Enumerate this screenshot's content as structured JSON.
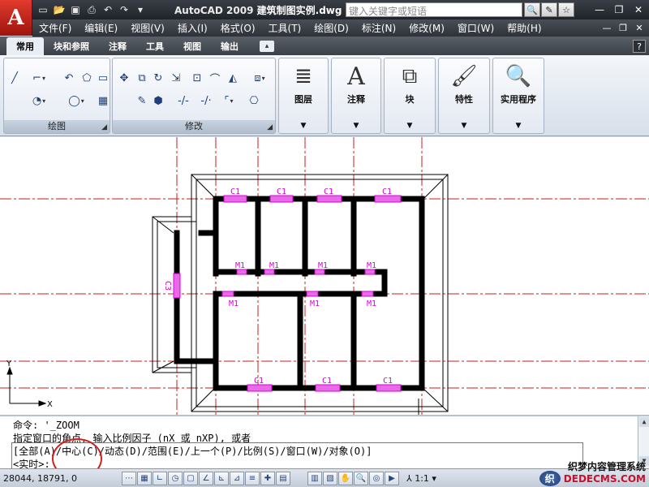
{
  "app": {
    "logo_letter": "A",
    "title_prefix": "AutoCAD 2009",
    "file_name": "建筑制图实例.dwg",
    "search_placeholder": "键入关键字或短语"
  },
  "menu": [
    "文件(F)",
    "编辑(E)",
    "视图(V)",
    "插入(I)",
    "格式(O)",
    "工具(T)",
    "绘图(D)",
    "标注(N)",
    "修改(M)",
    "窗口(W)",
    "帮助(H)"
  ],
  "ribbon_tabs": [
    "常用",
    "块和参照",
    "注释",
    "工具",
    "视图",
    "输出"
  ],
  "panels": {
    "draw_title": "绘图",
    "modify_title": "修改",
    "layers": "图层",
    "annotation": "注释",
    "block": "块",
    "properties": "特性",
    "utilities": "实用程序"
  },
  "drawing_labels": {
    "window": "C1",
    "door": "M1",
    "side_window": "C3",
    "axis_x": "X",
    "axis_y": "Y"
  },
  "command": {
    "line1": "命令: '_ZOOM",
    "line2": "指定窗口的角点, 输入比例因子 (nX 或 nXP), 或者",
    "line3": "[全部(A)/中心(C)/动态(D)/范围(E)/上一个(P)/比例(S)/窗口(W)/对象(O)]",
    "line4": "<实时>:"
  },
  "status": {
    "coords": "28044, 18791, 0",
    "scale": "1:1"
  },
  "watermark": {
    "text1": "织梦内容管理系统",
    "text2": "DEDECMS.COM"
  },
  "colors": {
    "accent_red": "#d21f1f",
    "wall": "#000000",
    "axis": "#c81e1e",
    "opening": "#d400d4"
  }
}
